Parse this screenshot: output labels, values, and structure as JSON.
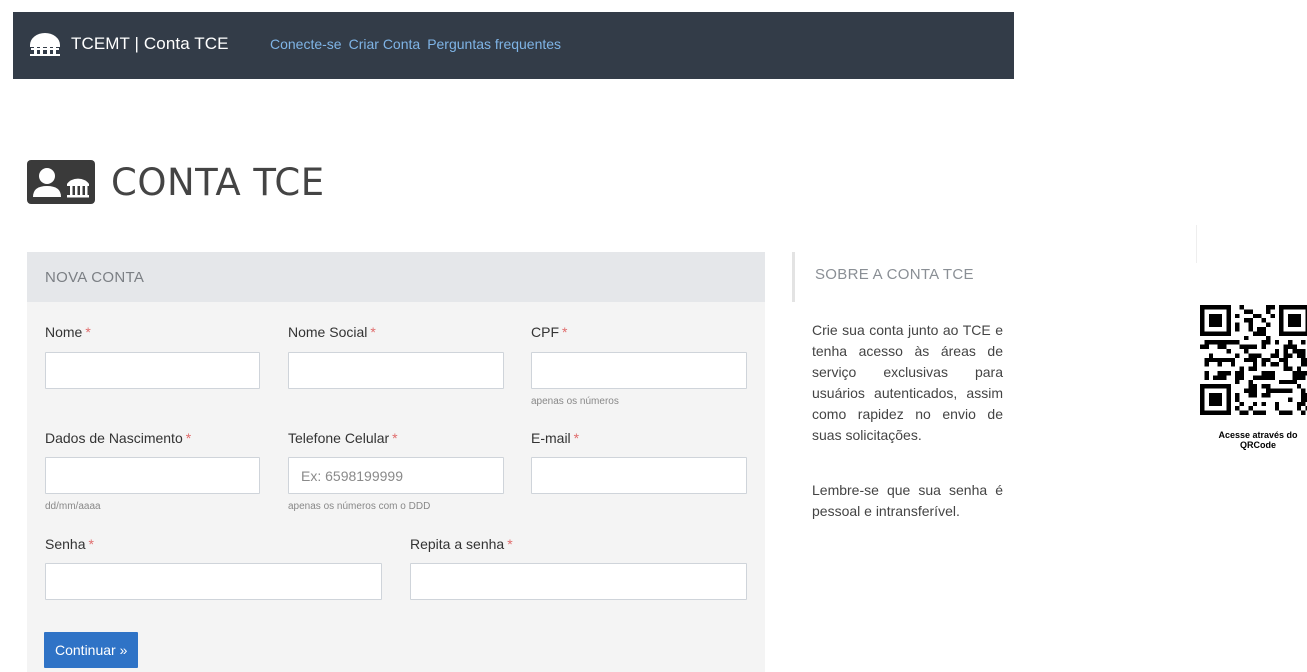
{
  "header": {
    "brand": "TCEMT | Conta TCE",
    "icon": "institution-icon",
    "nav": [
      "Conecte-se",
      "Criar Conta",
      "Perguntas frequentes"
    ]
  },
  "page": {
    "title": "CONTA TCE",
    "title_icon": "contact-card-icon"
  },
  "form": {
    "heading": "NOVA CONTA",
    "required_mark": "*",
    "fields": {
      "nome": {
        "label": "Nome"
      },
      "nome_social": {
        "label": "Nome Social"
      },
      "cpf": {
        "label": "CPF",
        "help": "apenas os números"
      },
      "nascimento": {
        "label": "Dados de Nascimento",
        "help": "dd/mm/aaaa"
      },
      "celular": {
        "label": "Telefone Celular",
        "placeholder": "Ex: 6598199999",
        "help": "apenas os números com o DDD"
      },
      "email": {
        "label": "E-mail"
      },
      "senha": {
        "label": "Senha"
      },
      "repita_senha": {
        "label": "Repita a senha"
      }
    },
    "submit": "Continuar »"
  },
  "sidebar": {
    "title": "SOBRE A CONTA TCE",
    "p1": "Crie sua conta junto ao TCE e tenha acesso às áreas de serviço exclusivas para usuários autenticados, assim como rapidez no envio de suas solicitações.",
    "p2": "Lembre-se que sua senha é pessoal e intransferível."
  },
  "qr": {
    "caption_line1": "Acesse através do",
    "caption_line2": "QRCode"
  },
  "colors": {
    "topbar": "#333c48",
    "link": "#7fb4e6",
    "button": "#2f73c6",
    "required": "#e06c6c"
  }
}
